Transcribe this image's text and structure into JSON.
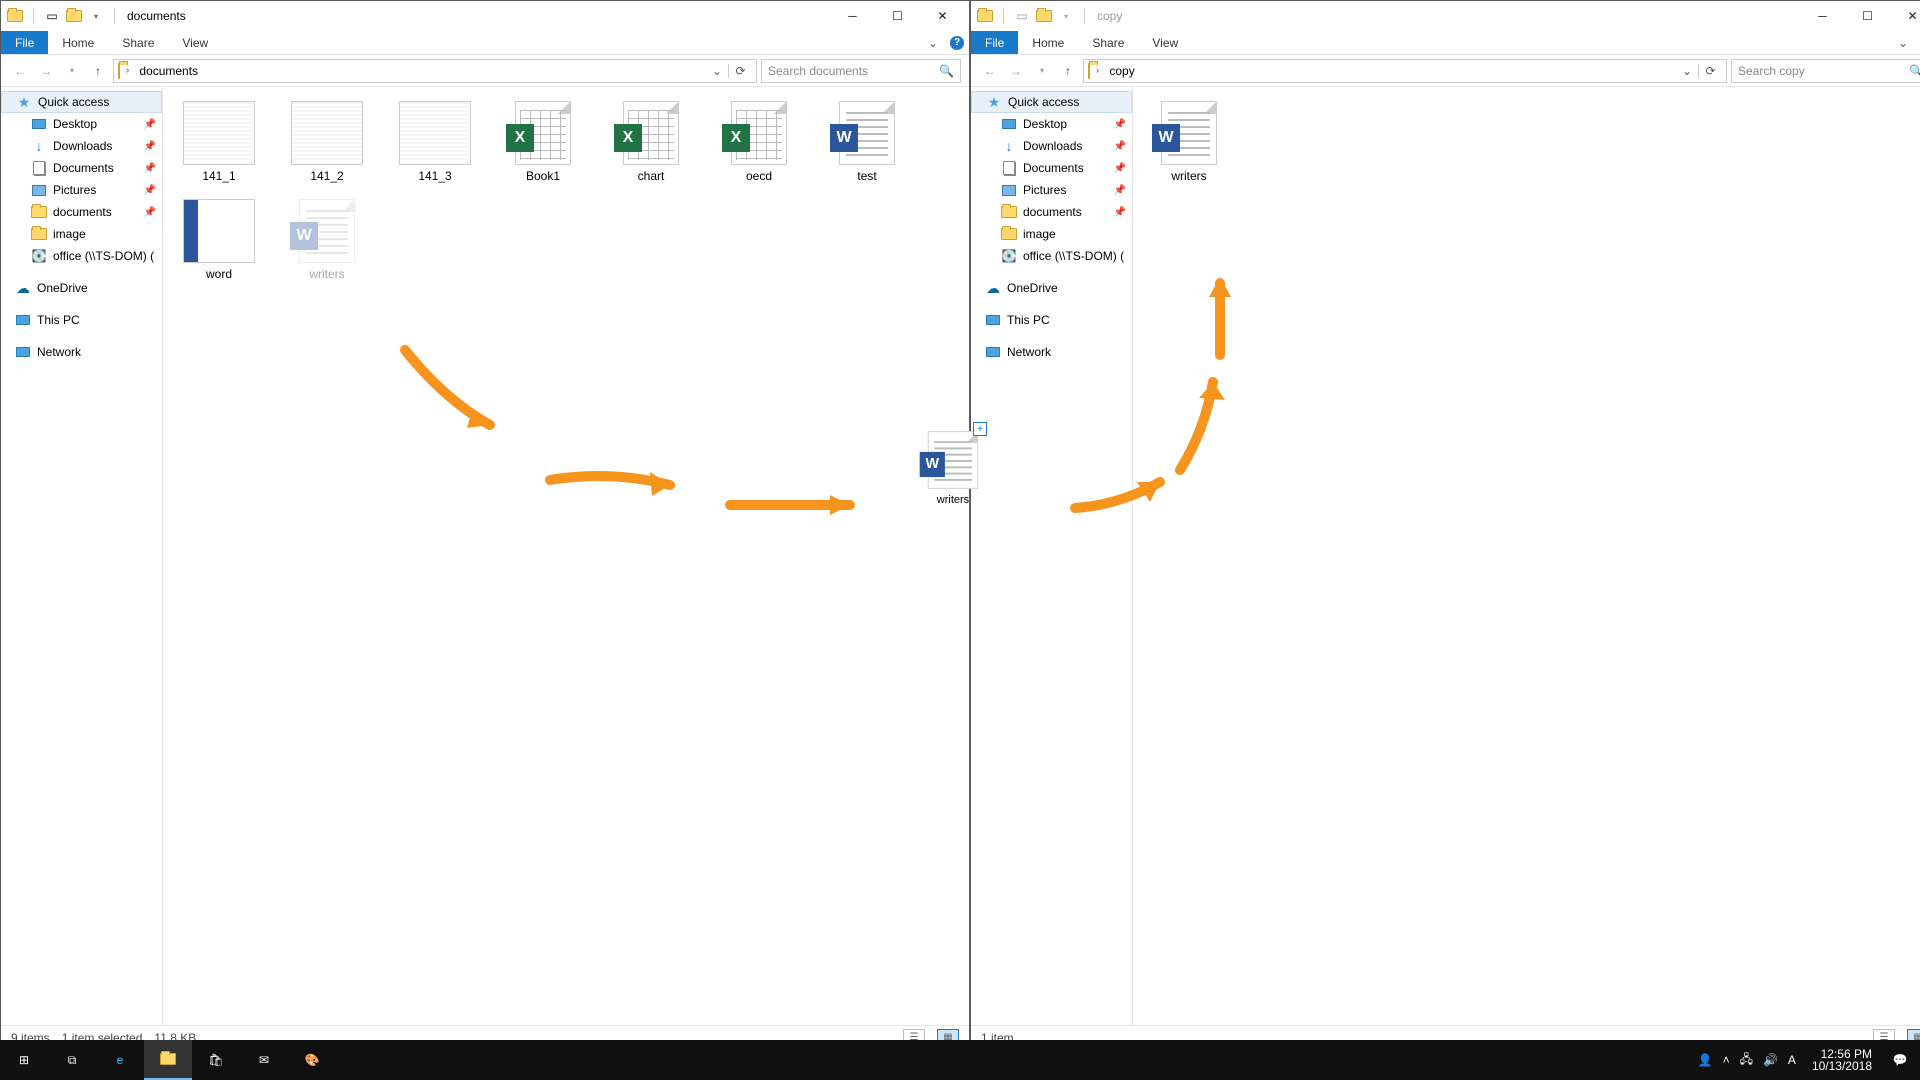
{
  "left": {
    "title": "documents",
    "tabs": {
      "file": "File",
      "home": "Home",
      "share": "Share",
      "view": "View"
    },
    "breadcrumb": "documents",
    "search_placeholder": "Search documents",
    "sidebar": {
      "quick": "Quick access",
      "desktop": "Desktop",
      "downloads": "Downloads",
      "documents": "Documents",
      "pictures": "Pictures",
      "folder_documents": "documents",
      "folder_image": "image",
      "office": "office (\\\\TS-DOM) (",
      "onedrive": "OneDrive",
      "thispc": "This PC",
      "network": "Network"
    },
    "files": {
      "f1": "141_1",
      "f2": "141_2",
      "f3": "141_3",
      "book": "Book1",
      "chart": "chart",
      "oecd": "oecd",
      "test": "test",
      "word": "word",
      "writers": "writers"
    },
    "status": {
      "count": "9 items",
      "sel": "1 item selected",
      "size": "11.8 KB"
    }
  },
  "right": {
    "title": "copy",
    "tabs": {
      "file": "File",
      "home": "Home",
      "share": "Share",
      "view": "View"
    },
    "breadcrumb": "copy",
    "search_placeholder": "Search copy",
    "sidebar": {
      "quick": "Quick access",
      "desktop": "Desktop",
      "downloads": "Downloads",
      "documents": "Documents",
      "pictures": "Pictures",
      "folder_documents": "documents",
      "folder_image": "image",
      "office": "office (\\\\TS-DOM) (",
      "onedrive": "OneDrive",
      "thispc": "This PC",
      "network": "Network"
    },
    "files": {
      "writers": "writers"
    },
    "status": {
      "count": "1 item"
    }
  },
  "drag": {
    "label": "writers"
  },
  "tray": {
    "time": "12:56 PM",
    "date": "10/13/2018"
  }
}
